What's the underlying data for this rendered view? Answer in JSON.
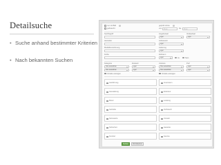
{
  "slide": {
    "title": "Detailsuche",
    "bullets": [
      "Suche anhand bestimmter Kriterien",
      "Nach bekannten Suchen"
    ]
  },
  "form": {
    "search_header": "Suche",
    "left": {
      "opt1": "nur mit Bild",
      "opt2": "gebraucht",
      "field1": "Suchbegriff",
      "field2": "Hersteller",
      "field3": "Modellbezeichnung",
      "field4": "Farbe",
      "col_a": "Kategorie",
      "col_b": "Zustand",
      "select_a": "bitte auswählen",
      "select_b": "egal",
      "select_c": "bitte auswählen",
      "select_d": "egal",
      "check": "Vorteile anzeigen"
    },
    "right": {
      "opt1": "geprüft online",
      "price_from": "von",
      "price_to": "bis",
      "from_ph": "Preis",
      "to_ph": "Preis",
      "col_a": "Angebotsart",
      "col_b": "Verkaufsart",
      "select_a": "egal",
      "select_b": "egal",
      "label_art": "Anbieterart",
      "select_c": "egal",
      "label_lieferung": "Lieferung",
      "select_d": "egal",
      "label_zeit": "Zeitraum",
      "select_e": "egal",
      "ja": "Ja",
      "nein": "Nein",
      "col_c": "Umkreis",
      "col_d": "PLZ",
      "select_f": "bitte auswählen",
      "select_g": "egal",
      "check": "Vorteile anzeigen"
    },
    "cards_left": [
      "Ausführung",
      "Ausstattung",
      "Motor",
      "Getriebe",
      "Karosserie",
      "Sicherheit",
      "Komfort"
    ],
    "cards_right": [
      "Innenraum",
      "Exterieur",
      "Leistung",
      "Verbrauch",
      "Umwelt",
      "Garantie",
      "Service"
    ],
    "submit_label": "Suchen",
    "reset_label": "Zurücksetzen"
  }
}
